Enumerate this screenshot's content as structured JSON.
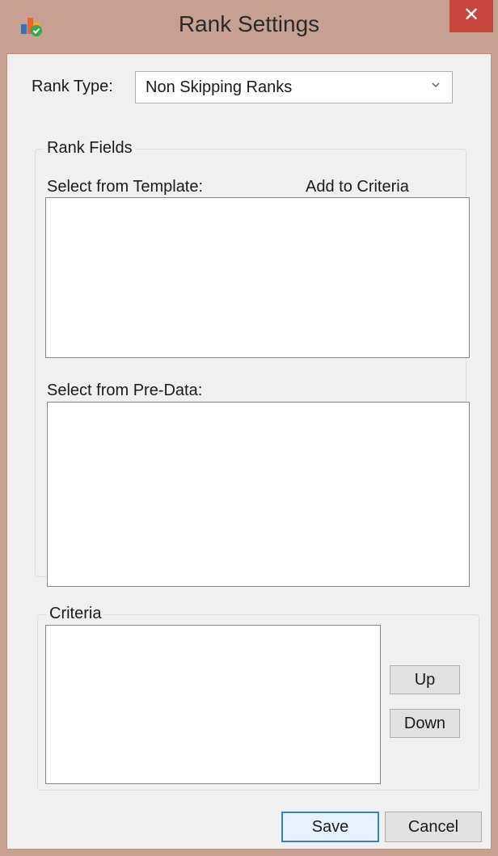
{
  "window": {
    "title": "Rank Settings",
    "close_label": "✕"
  },
  "rank_type": {
    "label": "Rank Type:",
    "selected": "Non Skipping Ranks"
  },
  "rank_fields": {
    "caption": "Rank Fields",
    "template_label": "Select from Template:",
    "add_label": "Add to Criteria",
    "predata_label": "Select from Pre-Data:"
  },
  "criteria": {
    "caption": "Criteria",
    "up_label": "Up",
    "down_label": "Down"
  },
  "footer": {
    "save_label": "Save",
    "cancel_label": "Cancel"
  },
  "icons": {
    "app": "bar-chart-check-icon",
    "close": "close-icon",
    "dropdown": "chevron-down-icon"
  }
}
